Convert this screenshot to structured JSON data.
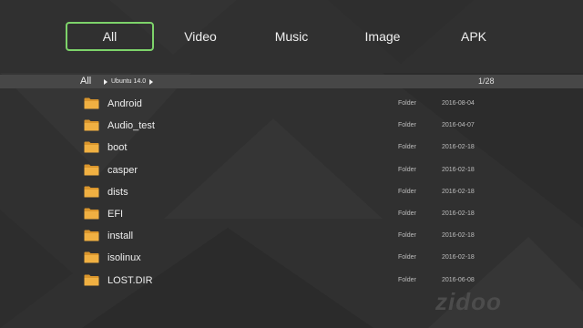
{
  "tabs": [
    {
      "label": "All",
      "active": true
    },
    {
      "label": "Video",
      "active": false
    },
    {
      "label": "Music",
      "active": false
    },
    {
      "label": "Image",
      "active": false
    },
    {
      "label": "APK",
      "active": false
    }
  ],
  "path": {
    "root": "All",
    "crumb": "Ubuntu 14.0",
    "counter": "1/28"
  },
  "files": [
    {
      "name": "Android",
      "type": "Folder",
      "date": "2016-08-04"
    },
    {
      "name": "Audio_test",
      "type": "Folder",
      "date": "2016-04-07"
    },
    {
      "name": "boot",
      "type": "Folder",
      "date": "2016-02-18"
    },
    {
      "name": "casper",
      "type": "Folder",
      "date": "2016-02-18"
    },
    {
      "name": "dists",
      "type": "Folder",
      "date": "2016-02-18"
    },
    {
      "name": "EFI",
      "type": "Folder",
      "date": "2016-02-18"
    },
    {
      "name": "install",
      "type": "Folder",
      "date": "2016-02-18"
    },
    {
      "name": "isolinux",
      "type": "Folder",
      "date": "2016-02-18"
    },
    {
      "name": "LOST.DIR",
      "type": "Folder",
      "date": "2016-06-08"
    }
  ],
  "watermark": "zidoo",
  "colors": {
    "background": "#303030",
    "pathbar": "#474747",
    "active_tab_border": "#7dd36a",
    "folder": "#f0b042"
  }
}
